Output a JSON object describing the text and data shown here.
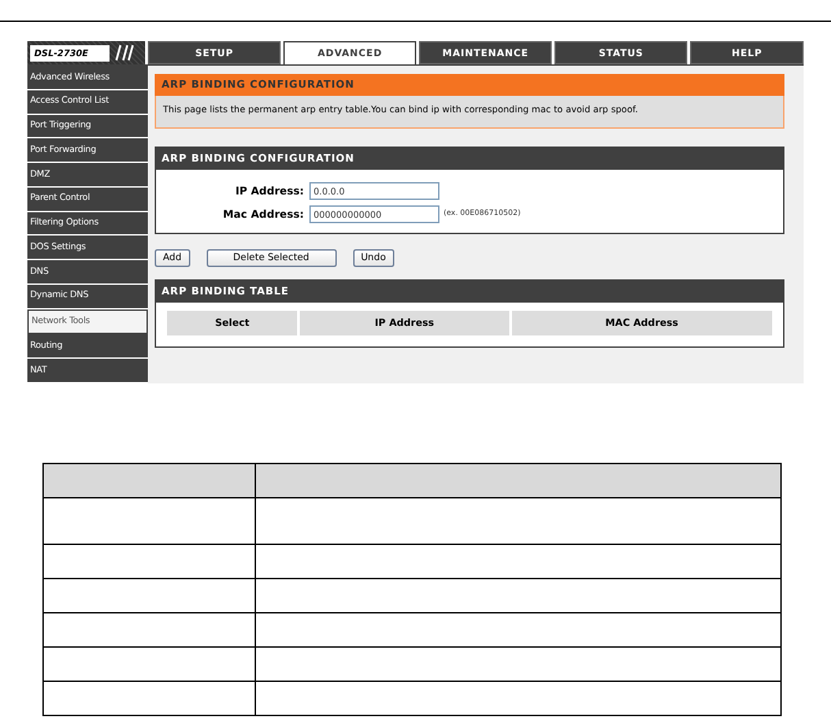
{
  "logo": {
    "text": "DSL-2730E"
  },
  "tabs": [
    {
      "label": "SETUP",
      "selected": false
    },
    {
      "label": "ADVANCED",
      "selected": true
    },
    {
      "label": "MAINTENANCE",
      "selected": false
    },
    {
      "label": "STATUS",
      "selected": false
    },
    {
      "label": "HELP",
      "selected": false
    }
  ],
  "sidebar": {
    "items": [
      {
        "label": "Advanced Wireless",
        "selected": false
      },
      {
        "label": "Access Control List",
        "selected": false
      },
      {
        "label": "Port Triggering",
        "selected": false
      },
      {
        "label": "Port Forwarding",
        "selected": false
      },
      {
        "label": "DMZ",
        "selected": false
      },
      {
        "label": "Parent Control",
        "selected": false
      },
      {
        "label": "Filtering Options",
        "selected": false
      },
      {
        "label": "DOS Settings",
        "selected": false
      },
      {
        "label": "DNS",
        "selected": false
      },
      {
        "label": "Dynamic DNS",
        "selected": false
      },
      {
        "label": "Network Tools",
        "selected": true
      },
      {
        "label": "Routing",
        "selected": false
      },
      {
        "label": "NAT",
        "selected": false
      }
    ]
  },
  "notice": {
    "title": "ARP BINDING CONFIGURATION",
    "text": "This page lists the permanent arp entry table.You can bind ip with corresponding mac to avoid arp spoof."
  },
  "config": {
    "title": "ARP BINDING CONFIGURATION",
    "fields": [
      {
        "label": "IP Address:",
        "value": "0.0.0.0"
      },
      {
        "label": "Mac Address:",
        "value": "000000000000",
        "hint": "(ex. 00E086710502)"
      }
    ]
  },
  "buttons": [
    "Add",
    "Delete Selected",
    "Undo"
  ],
  "binding_table": {
    "title": "ARP BINDING TABLE",
    "columns": [
      "Select",
      "IP Address",
      "MAC Address"
    ]
  },
  "doc_table": {
    "rows": [
      {
        "kind": "header"
      },
      {
        "kind": "tall"
      },
      {
        "kind": "normal"
      },
      {
        "kind": "normal"
      },
      {
        "kind": "normal"
      },
      {
        "kind": "normal"
      },
      {
        "kind": "normal"
      }
    ]
  }
}
